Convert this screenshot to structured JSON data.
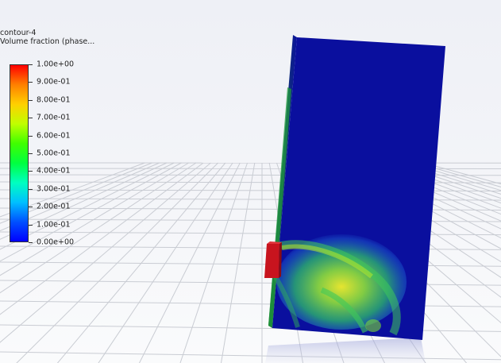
{
  "legend": {
    "name": "contour-4",
    "field": "Volume fraction (phase..."
  },
  "colorbar": {
    "min": 0.0,
    "max": 1.0,
    "tick_labels": [
      "1.00e+00",
      "9.00e-01",
      "8.00e-01",
      "7.00e-01",
      "6.00e-01",
      "5.00e-01",
      "4.00e-01",
      "3.00e-01",
      "2.00e-01",
      "1.00e-01",
      "0.00e+00"
    ],
    "colors": [
      "#ff0000",
      "#ff8000",
      "#ffd000",
      "#c0ff00",
      "#40ff00",
      "#00ff40",
      "#00ffc0",
      "#00c0ff",
      "#0050ff",
      "#0000ff"
    ]
  },
  "scene": {
    "domain_color": "#0a0f9e",
    "floor_grid_color": "#c8cbd2",
    "wall_color": "#1a8a3a",
    "inlet_color": "#c8141e",
    "plume_colors": [
      "#7cd936",
      "#3fb85a",
      "#2b7ad6"
    ]
  }
}
